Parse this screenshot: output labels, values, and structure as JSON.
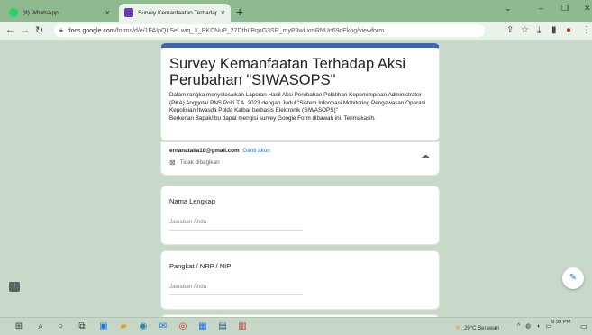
{
  "tabs": [
    {
      "title": "(8) WhatsApp",
      "favicon_color": "#25d366"
    },
    {
      "title": "Survey Kemanfaatan Terhadap A",
      "favicon_color": "#673ab7"
    }
  ],
  "toolbar": {
    "url_host": "docs.google.com",
    "url_path": "/forms/d/e/1FAIpQLSeLwiq_X_PKCNuP_27DtbLBqoG3SR_myP8wLxmRNUn69cEkog/viewform"
  },
  "form": {
    "title": "Survey Kemanfaatan Terhadap Aksi Perubahan \"SIWASOPS\"",
    "description": "Dalam rangka menyelesaikan Laporan Hasil Aksi Perubahan Pelatihan Kepemimpinan Administrator (PKA) Anggota/ PNS Polri T.A. 2023 dengan Judul \"Sistem Informasi Monitoring Pengawasan Operasi Kepolisian Itwasda Polda Kalbar berbasis Elektronik (SIWASOPS)\"",
    "description2": "Berkenan Bapak/Ibu dapat mengisi survey Google Form dibawah ini. Terimakasih.",
    "account_email": "ernanatalia18@gmail.com",
    "switch_account": "Ganti akun",
    "not_shared": "Tidak dibagikan",
    "questions": [
      {
        "label": "Nama Lengkap",
        "placeholder": "Jawaban Anda"
      },
      {
        "label": "Pangkat / NRP / NIP",
        "placeholder": "Jawaban Anda"
      }
    ]
  },
  "taskbar": {
    "weather": "29°C  Berawan",
    "time": "9:33 PM"
  },
  "colors": {
    "accent": "#3d66b8",
    "link": "#1a73e8"
  }
}
